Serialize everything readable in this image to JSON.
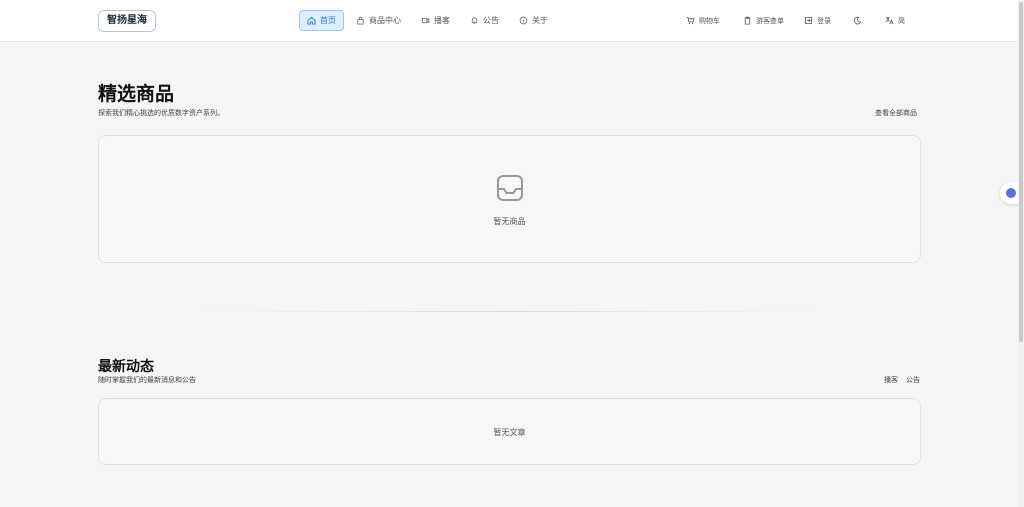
{
  "header": {
    "logo": "智扬星海",
    "nav": [
      {
        "label": "首页",
        "icon": "home-icon",
        "active": true
      },
      {
        "label": "商品中心",
        "icon": "bag-icon",
        "active": false
      },
      {
        "label": "播客",
        "icon": "video-icon",
        "active": false
      },
      {
        "label": "公告",
        "icon": "bell-icon",
        "active": false
      },
      {
        "label": "关于",
        "icon": "info-icon",
        "active": false
      }
    ],
    "cart": "购物车",
    "guest_order": "游客查单",
    "login": "登录",
    "lang": "简"
  },
  "products": {
    "title": "精选商品",
    "subtitle": "探索我们精心挑选的优质数字资产系列。",
    "view_all": "查看全部商品",
    "empty": "暂无商品"
  },
  "news": {
    "title": "最新动态",
    "subtitle": "随时掌握我们的最新消息和公告",
    "tab_podcast": "播客",
    "tab_notice": "公告",
    "empty": "暂无文章"
  },
  "colors": {
    "accent": "#2b7bd3",
    "active_bg": "#ddeeff"
  }
}
